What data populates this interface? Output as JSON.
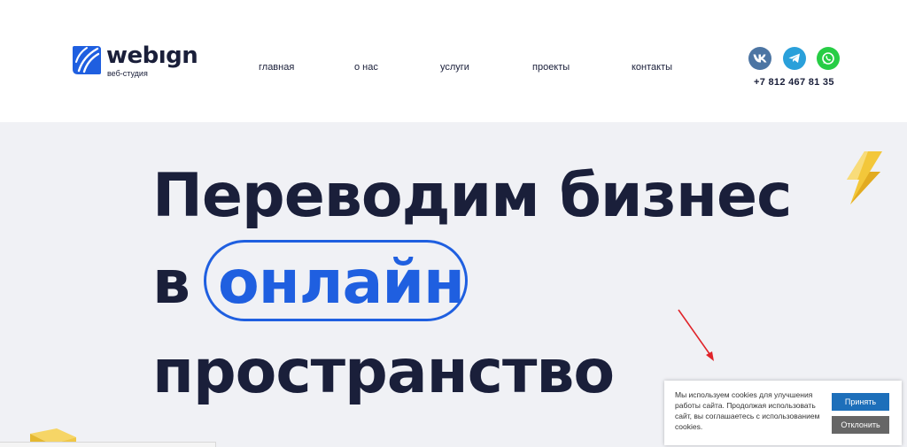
{
  "brand": {
    "word": "webıgn",
    "subtitle": "веб-студия",
    "color": "#1f5fe0"
  },
  "nav": {
    "items": [
      {
        "label": "главная"
      },
      {
        "label": "о нас"
      },
      {
        "label": "услуги"
      },
      {
        "label": "проекты"
      },
      {
        "label": "контакты"
      }
    ]
  },
  "social": {
    "icons": [
      "vk-icon",
      "telegram-icon",
      "whatsapp-icon"
    ],
    "phone": "+7 812 467 81 35"
  },
  "hero": {
    "line1": "Переводим бизнес",
    "line2_prefix": "в",
    "line2_highlight": "онлайн",
    "line3": "пространство",
    "highlight_color": "#1f5fe0",
    "text_color": "#1a1f3a",
    "background": "#f0f1f5"
  },
  "cookie": {
    "text": "Мы используем cookies для улучшения работы сайта. Продолжая использовать сайт, вы соглашаетесь с использованием cookies.",
    "accept_label": "Принять",
    "decline_label": "Отклонить"
  }
}
